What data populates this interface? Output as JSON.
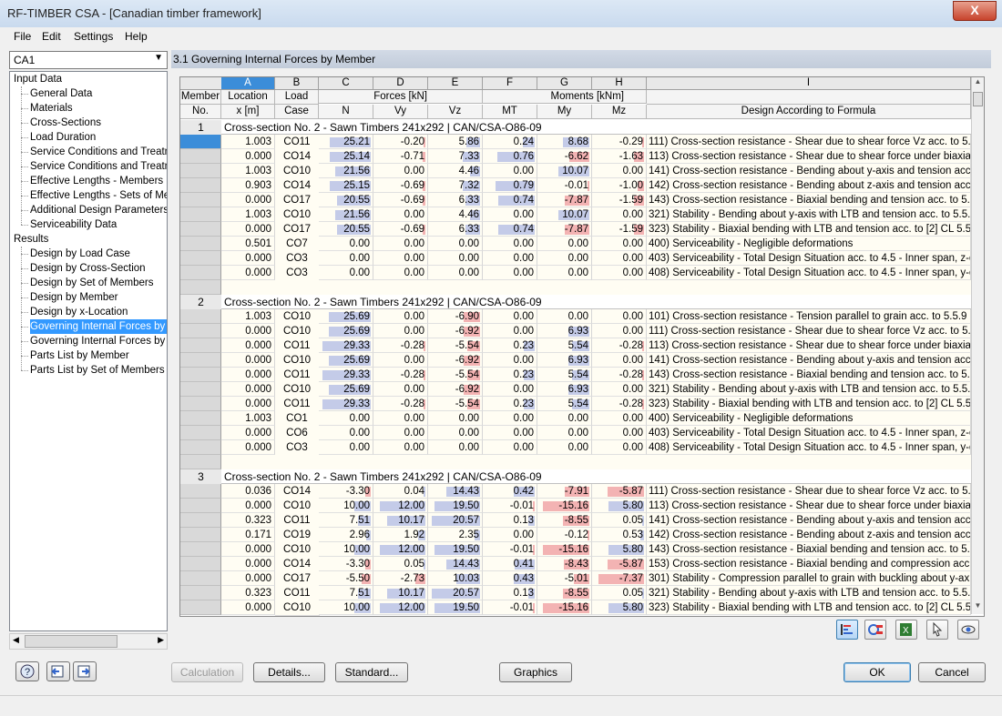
{
  "window": {
    "title": "RF-TIMBER CSA - [Canadian timber framework]",
    "close": "X"
  },
  "menu": [
    "File",
    "Edit",
    "Settings",
    "Help"
  ],
  "case_selector": {
    "value": "CA1"
  },
  "tree": {
    "input_label": "Input Data",
    "input_items": [
      "General Data",
      "Materials",
      "Cross-Sections",
      "Load Duration",
      "Service Conditions and Treatme",
      "Service Conditions and Treatme",
      "Effective Lengths - Members",
      "Effective Lengths - Sets of Mer",
      "Additional Design Parameters",
      "Serviceability Data"
    ],
    "results_label": "Results",
    "results_items": [
      "Design by Load Case",
      "Design by Cross-Section",
      "Design by Set of Members",
      "Design by Member",
      "Design by x-Location",
      "Governing Internal Forces by M",
      "Governing Internal Forces by S",
      "Parts List by Member",
      "Parts List by Set of Members"
    ],
    "selected_index": 5
  },
  "section_title": "3.1  Governing Internal Forces by Member",
  "table": {
    "col_letters": [
      "A",
      "B",
      "C",
      "D",
      "E",
      "F",
      "G",
      "H",
      "I"
    ],
    "active_col": "A",
    "hdr_member": [
      "Member",
      "No."
    ],
    "hdr_location": [
      "Location",
      "x [m]"
    ],
    "hdr_loadcase": [
      "Load",
      "Case"
    ],
    "hdr_forces": "Forces [kN]",
    "hdr_moments": "Moments [kNm]",
    "hdr_N": "N",
    "hdr_Vy": "Vy",
    "hdr_Vz": "Vz",
    "hdr_MT": "MT",
    "hdr_My": "My",
    "hdr_Mz": "Mz",
    "hdr_formula": "Design According to Formula",
    "groups": [
      {
        "member": "1",
        "title": "Cross-section No. 2 - Sawn Timbers 241x292 | CAN/CSA-O86-09",
        "rows": [
          [
            "1.003",
            "CO11",
            "25.21",
            "-0.20",
            "5.86",
            "0.24",
            "8.68",
            "-0.29",
            "111) Cross-section resistance - Shear due to shear force Vz acc. to 5.5.5"
          ],
          [
            "0.000",
            "CO14",
            "25.14",
            "-0.71",
            "7.33",
            "0.76",
            "-6.62",
            "-1.63",
            "113) Cross-section resistance - Shear due to shear force under biaxial ber"
          ],
          [
            "1.003",
            "CO10",
            "21.56",
            "0.00",
            "4.46",
            "0.00",
            "10.07",
            "0.00",
            "141) Cross-section resistance - Bending about y-axis and tension acc. to !"
          ],
          [
            "0.903",
            "CO14",
            "25.15",
            "-0.69",
            "7.32",
            "0.79",
            "-0.01",
            "-1.00",
            "142) Cross-section resistance - Bending about z-axis and tension acc. to !"
          ],
          [
            "0.000",
            "CO17",
            "20.55",
            "-0.69",
            "6.33",
            "0.74",
            "-7.87",
            "-1.59",
            "143) Cross-section resistance - Biaxial bending and tension acc. to 5.5.10"
          ],
          [
            "1.003",
            "CO10",
            "21.56",
            "0.00",
            "4.46",
            "0.00",
            "10.07",
            "0.00",
            "321) Stability - Bending about y-axis with LTB and tension acc. to 5.5.10 c"
          ],
          [
            "0.000",
            "CO17",
            "20.55",
            "-0.69",
            "6.33",
            "0.74",
            "-7.87",
            "-1.59",
            "323) Stability - Biaxial bending with LTB and tension acc. to [2] CL 5.5.10"
          ],
          [
            "0.501",
            "CO7",
            "0.00",
            "0.00",
            "0.00",
            "0.00",
            "0.00",
            "0.00",
            "400) Serviceability - Negligible deformations"
          ],
          [
            "0.000",
            "CO3",
            "0.00",
            "0.00",
            "0.00",
            "0.00",
            "0.00",
            "0.00",
            "403) Serviceability - Total Design Situation acc. to 4.5 - Inner span, z-direc"
          ],
          [
            "0.000",
            "CO3",
            "0.00",
            "0.00",
            "0.00",
            "0.00",
            "0.00",
            "0.00",
            "408) Serviceability - Total Design Situation acc. to 4.5 - Inner span, y-direc"
          ]
        ]
      },
      {
        "member": "2",
        "title": "Cross-section No. 2 - Sawn Timbers 241x292 | CAN/CSA-O86-09",
        "rows": [
          [
            "1.003",
            "CO10",
            "25.69",
            "0.00",
            "-6.90",
            "0.00",
            "0.00",
            "0.00",
            "101) Cross-section resistance - Tension parallel to grain acc. to 5.5.9 or 6"
          ],
          [
            "0.000",
            "CO10",
            "25.69",
            "0.00",
            "-6.92",
            "0.00",
            "6.93",
            "0.00",
            "111) Cross-section resistance - Shear due to shear force Vz acc. to 5.5.5"
          ],
          [
            "0.000",
            "CO11",
            "29.33",
            "-0.28",
            "-5.54",
            "0.23",
            "5.54",
            "-0.28",
            "113) Cross-section resistance - Shear due to shear force under biaxial ber"
          ],
          [
            "0.000",
            "CO10",
            "25.69",
            "0.00",
            "-6.92",
            "0.00",
            "6.93",
            "0.00",
            "141) Cross-section resistance - Bending about y-axis and tension acc. to !"
          ],
          [
            "0.000",
            "CO11",
            "29.33",
            "-0.28",
            "-5.54",
            "0.23",
            "5.54",
            "-0.28",
            "143) Cross-section resistance - Biaxial bending and tension acc. to 5.5.10"
          ],
          [
            "0.000",
            "CO10",
            "25.69",
            "0.00",
            "-6.92",
            "0.00",
            "6.93",
            "0.00",
            "321) Stability - Bending about y-axis with LTB and tension acc. to 5.5.10 c"
          ],
          [
            "0.000",
            "CO11",
            "29.33",
            "-0.28",
            "-5.54",
            "0.23",
            "5.54",
            "-0.28",
            "323) Stability - Biaxial bending with LTB and tension acc. to [2] CL 5.5.10"
          ],
          [
            "1.003",
            "CO1",
            "0.00",
            "0.00",
            "0.00",
            "0.00",
            "0.00",
            "0.00",
            "400) Serviceability - Negligible deformations"
          ],
          [
            "0.000",
            "CO6",
            "0.00",
            "0.00",
            "0.00",
            "0.00",
            "0.00",
            "0.00",
            "403) Serviceability - Total Design Situation acc. to 4.5 - Inner span, z-direc"
          ],
          [
            "0.000",
            "CO3",
            "0.00",
            "0.00",
            "0.00",
            "0.00",
            "0.00",
            "0.00",
            "408) Serviceability - Total Design Situation acc. to 4.5 - Inner span, y-direc"
          ]
        ]
      },
      {
        "member": "3",
        "title": "Cross-section No. 2 - Sawn Timbers 241x292 | CAN/CSA-O86-09",
        "rows": [
          [
            "0.036",
            "CO14",
            "-3.30",
            "0.04",
            "14.43",
            "0.42",
            "-7.91",
            "-5.87",
            "111) Cross-section resistance - Shear due to shear force Vz acc. to 5.5.5"
          ],
          [
            "0.000",
            "CO10",
            "10.00",
            "12.00",
            "19.50",
            "-0.01",
            "-15.16",
            "5.80",
            "113) Cross-section resistance - Shear due to shear force under biaxial ber"
          ],
          [
            "0.323",
            "CO11",
            "7.51",
            "10.17",
            "20.57",
            "0.13",
            "-8.55",
            "0.05",
            "141) Cross-section resistance - Bending about y-axis and tension acc. to !"
          ],
          [
            "0.171",
            "CO19",
            "2.96",
            "1.92",
            "2.35",
            "0.00",
            "-0.12",
            "0.53",
            "142) Cross-section resistance - Bending about z-axis and tension acc. to !"
          ],
          [
            "0.000",
            "CO10",
            "10.00",
            "12.00",
            "19.50",
            "-0.01",
            "-15.16",
            "5.80",
            "143) Cross-section resistance - Biaxial bending and tension acc. to 5.5.10"
          ],
          [
            "0.000",
            "CO14",
            "-3.30",
            "0.05",
            "14.43",
            "0.41",
            "-8.43",
            "-5.87",
            "153) Cross-section resistance - Biaxial bending and compression acc. to ["
          ],
          [
            "0.000",
            "CO17",
            "-5.50",
            "-2.73",
            "10.03",
            "0.43",
            "-5.01",
            "-7.37",
            "301) Stability - Compression parallel to grain with buckling about y-axis acc"
          ],
          [
            "0.323",
            "CO11",
            "7.51",
            "10.17",
            "20.57",
            "0.13",
            "-8.55",
            "0.05",
            "321) Stability - Bending about y-axis with LTB and tension acc. to 5.5.10 c"
          ],
          [
            "0.000",
            "CO10",
            "10.00",
            "12.00",
            "19.50",
            "-0.01",
            "-15.16",
            "5.80",
            "323) Stability - Biaxial bending with LTB and tension acc. to [2] CL 5.5.10"
          ]
        ]
      }
    ]
  },
  "buttons": {
    "calculation": "Calculation",
    "details": "Details...",
    "standard": "Standard...",
    "graphics": "Graphics",
    "ok": "OK",
    "cancel": "Cancel"
  },
  "colors": {
    "bar_pos": "#c4cbe8",
    "bar_neg": "#f3b3b3",
    "selection": "#3399ff",
    "header_active": "#3b8dd9"
  }
}
